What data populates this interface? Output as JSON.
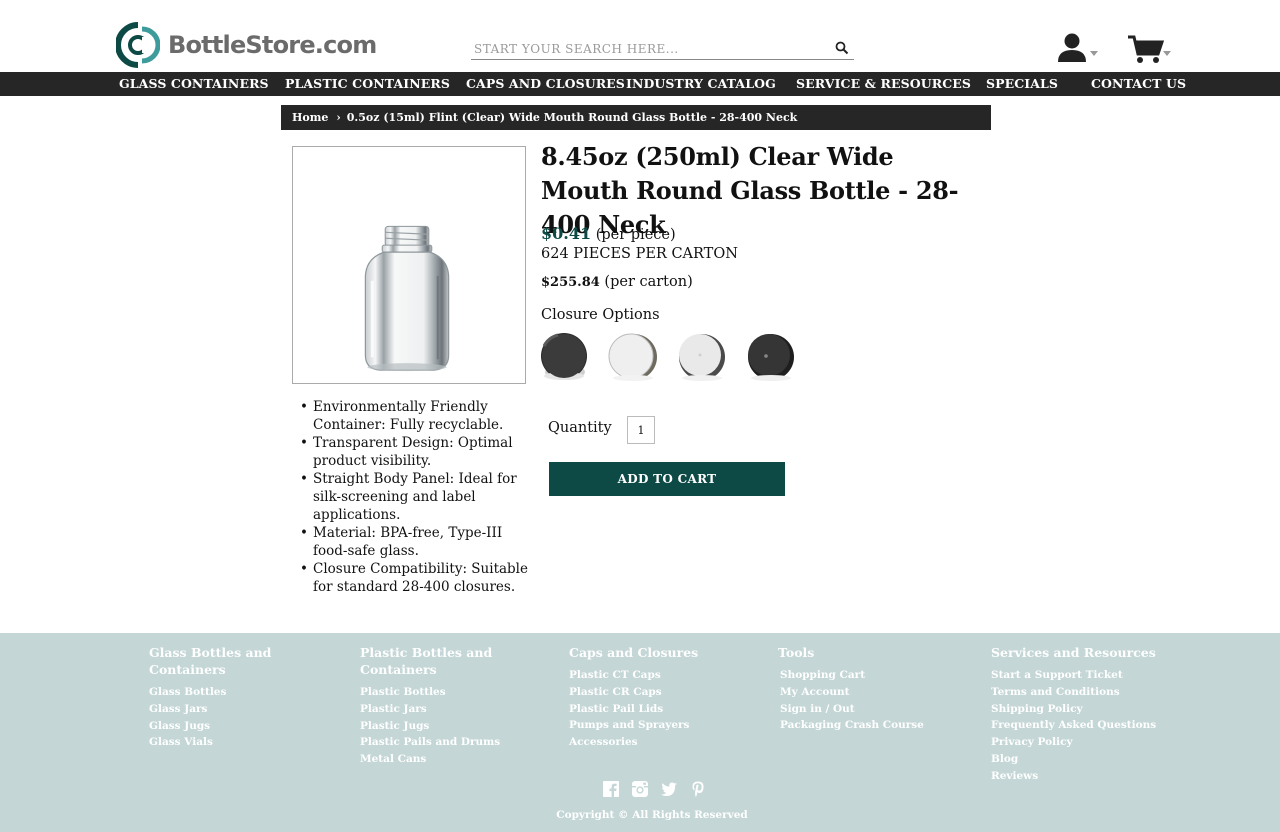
{
  "header": {
    "logo_text": "BottleStore.com",
    "search_placeholder": "START YOUR SEARCH HERE...",
    "brand_color": "#0d4a45",
    "accent_color": "#3e9b9b"
  },
  "nav": {
    "items": [
      {
        "label": "GLASS CONTAINERS"
      },
      {
        "label": "PLASTIC CONTAINERS"
      },
      {
        "label": "CAPS AND CLOSURES"
      },
      {
        "label": "INDUSTRY CATALOG"
      },
      {
        "label": "SERVICE & RESOURCES"
      },
      {
        "label": "SPECIALS"
      },
      {
        "label": "CONTACT US"
      }
    ]
  },
  "breadcrumb": {
    "home": "Home",
    "separator": "›",
    "current": "0.5oz (15ml) Flint (Clear) Wide Mouth Round Glass Bottle - 28-400 Neck"
  },
  "product": {
    "title": "8.45oz (250ml) Clear Wide Mouth Round Glass Bottle - 28-400 Neck",
    "price": "$0.41",
    "price_unit": "(per piece)",
    "pieces_per_carton": "624 PIECES PER CARTON",
    "carton_price": "$255.84",
    "carton_unit": "(per carton)",
    "closure_label": "Closure Options",
    "closures": [
      {
        "icon": "black-ribbed-cap-icon"
      },
      {
        "icon": "white-smooth-cap-icon"
      },
      {
        "icon": "white-ribbed-cap-icon"
      },
      {
        "icon": "black-ribbed-cap-icon"
      }
    ],
    "quantity_label": "Quantity",
    "quantity_value": "1",
    "add_to_cart_label": "ADD TO CART",
    "features": [
      "Environmentally Friendly Container: Fully recyclable.",
      "Transparent Design: Optimal product visibility.",
      "Straight Body Panel: Ideal for silk-screening and label applications.",
      "Material: BPA-free, Type-III food-safe glass.",
      "Closure Compatibility: Suitable for standard 28-400 closures."
    ]
  },
  "footer": {
    "columns": [
      {
        "heading": "Glass Bottles and Containers",
        "links": [
          "Glass Bottles",
          "Glass Jars",
          "Glass Jugs",
          "Glass Vials"
        ]
      },
      {
        "heading": "Plastic Bottles and Containers",
        "links": [
          "Plastic Bottles",
          "Plastic Jars",
          "Plastic Jugs",
          "Plastic Pails and Drums",
          "Metal Cans"
        ]
      },
      {
        "heading": "Caps and Closures",
        "links": [
          "Plastic CT Caps",
          "Plastic CR Caps",
          "Plastic Pail Lids",
          "Pumps and Sprayers",
          "Accessories"
        ]
      },
      {
        "heading": "Tools",
        "links": [
          "Shopping Cart",
          "My Account",
          "Sign in / Out",
          "Packaging Crash Course"
        ]
      },
      {
        "heading": "Services and Resources",
        "links": [
          "Start a Support Ticket",
          "Terms and Conditions",
          "Shipping Policy",
          "Frequently Asked Questions",
          "Privacy Policy",
          "Blog",
          "Reviews"
        ]
      }
    ],
    "social_icons": [
      "facebook-icon",
      "instagram-icon",
      "twitter-icon",
      "pinterest-icon"
    ],
    "copyright": "Copyright © All Rights Reserved"
  }
}
